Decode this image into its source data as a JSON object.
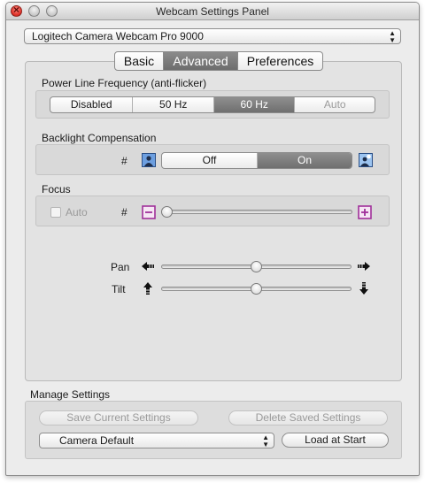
{
  "window": {
    "title": "Webcam Settings Panel"
  },
  "camera_select": {
    "value": "Logitech Camera Webcam Pro 9000"
  },
  "tabs": [
    {
      "label": "Basic"
    },
    {
      "label": "Advanced",
      "active": true
    },
    {
      "label": "Preferences"
    }
  ],
  "power_line": {
    "label": "Power Line Frequency (anti-flicker)",
    "options": [
      "Disabled",
      "50 Hz",
      "60 Hz",
      "Auto"
    ],
    "selected": "60 Hz",
    "disabled_options": [
      "Auto"
    ]
  },
  "backlight": {
    "label": "Backlight Compensation",
    "hash": "#",
    "options": [
      "Off",
      "On"
    ],
    "selected": "On",
    "left_icon": "backlight-off-icon",
    "right_icon": "backlight-on-icon"
  },
  "focus": {
    "label": "Focus",
    "auto_label": "Auto",
    "auto_checked": false,
    "hash": "#",
    "minus_icon": "minus-icon",
    "plus_icon": "plus-icon",
    "value": 0
  },
  "pan": {
    "label": "Pan",
    "value": 0.5,
    "left_icon": "arrow-left-icon",
    "right_icon": "arrow-right-icon"
  },
  "tilt": {
    "label": "Tilt",
    "value": 0.5,
    "up_icon": "arrow-up-icon",
    "down_icon": "arrow-down-icon"
  },
  "manage": {
    "label": "Manage Settings",
    "save_button": "Save Current Settings",
    "delete_button": "Delete Saved Settings",
    "preset_value": "Camera Default",
    "load_button": "Load at Start"
  },
  "colors": {
    "selected_segment": "#7a7a7a",
    "accent_icon_blue": "#5b8fd6",
    "accent_icon_magenta": "#b23aa8"
  }
}
